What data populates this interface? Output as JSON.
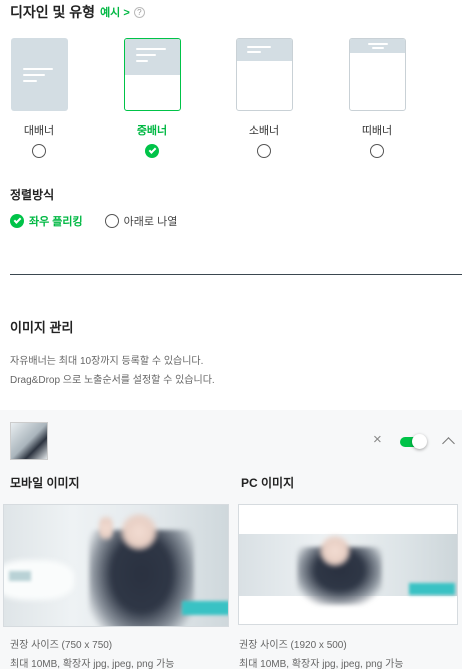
{
  "design": {
    "title": "디자인 및 유형",
    "example_link": "예시 >",
    "help_glyph": "?",
    "options": [
      {
        "label": "대배너",
        "selected": false
      },
      {
        "label": "중배너",
        "selected": true
      },
      {
        "label": "소배너",
        "selected": false
      },
      {
        "label": "띠배너",
        "selected": false
      }
    ]
  },
  "alignment": {
    "title": "정렬방식",
    "options": [
      {
        "label": "좌우 플리킹",
        "selected": true
      },
      {
        "label": "아래로 나열",
        "selected": false
      }
    ]
  },
  "image_management": {
    "title": "이미지 관리",
    "descriptions": [
      "자유배너는 최대 10장까지 등록할 수 있습니다.",
      "Drag&Drop 으로 노출순서를 설정할 수 있습니다."
    ]
  },
  "image_card": {
    "close_glyph": "×",
    "toggle_on": true,
    "mobile": {
      "title": "모바일 이미지",
      "recommended": "권장 사이즈 (750 x 750)",
      "limit": "최대 10MB, 확장자 jpg, jpeg, png 가능"
    },
    "pc": {
      "title": "PC 이미지",
      "recommended": "권장 사이즈 (1920 x 500)",
      "limit": "최대 10MB, 확장자 jpg, jpeg, png 가능"
    }
  },
  "colors": {
    "accent_green": "#00c348",
    "placeholder_gray": "#d3dde3",
    "divider": "#3b4750",
    "card_background": "#f7f8f9"
  },
  "icons": [
    "help-icon",
    "check-icon",
    "close-icon",
    "toggle-switch",
    "chevron-up-icon"
  ]
}
